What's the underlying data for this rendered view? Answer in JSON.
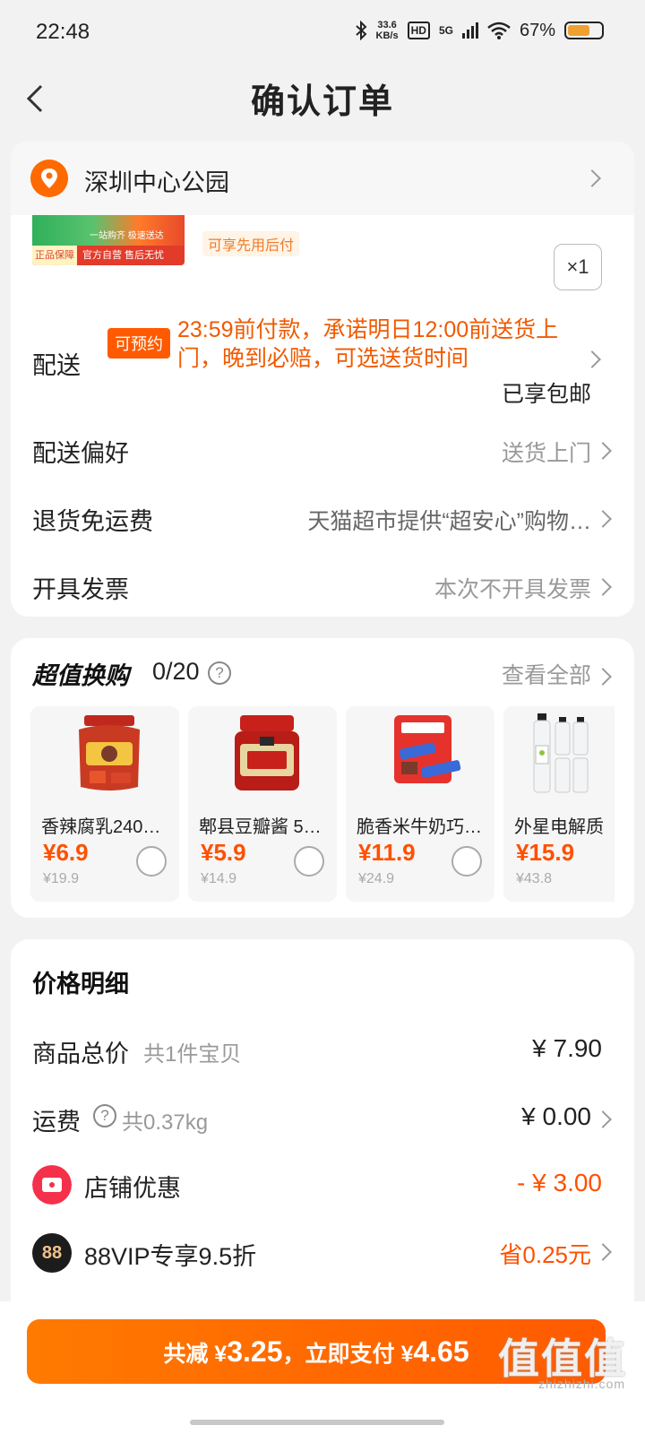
{
  "status_bar": {
    "time": "22:48",
    "net_speed_value": "33.6",
    "net_speed_unit": "KB/s",
    "hd": "HD",
    "network": "5G",
    "battery": "67%",
    "battery_level": 0.67
  },
  "nav": {
    "title": "确认订单"
  },
  "address": {
    "text": "深圳中心公园"
  },
  "product": {
    "thumb_badge": "正品保障",
    "thumb_service": "官方自营 售后无忧",
    "thumb_promo": "一站购齐 极速送达",
    "pay_later": "可享先用后付",
    "quantity": "×1"
  },
  "delivery": {
    "label": "配送",
    "tag": "可预约",
    "promise": "23:59前付款，承诺明日12:00前送货上门，晚到必赔，可选送货时间",
    "free_shipping": "已享包邮"
  },
  "order_rows": [
    {
      "label": "配送偏好",
      "value": "送货上门"
    },
    {
      "label": "退货免运费",
      "value": "天猫超市提供“超安心”购物…"
    },
    {
      "label": "开具发票",
      "value": "本次不开具发票"
    }
  ],
  "exchange": {
    "title": "超值换购",
    "count": "0/20",
    "view_all": "查看全部",
    "products": [
      {
        "name": "香辣腐乳240…",
        "price": "¥6.9",
        "old_price": "¥19.9"
      },
      {
        "name": "郫县豆瓣酱 5…",
        "price": "¥5.9",
        "old_price": "¥14.9"
      },
      {
        "name": "脆香米牛奶巧…",
        "price": "¥11.9",
        "old_price": "¥24.9"
      },
      {
        "name": "外星电解质",
        "price": "¥15.9",
        "old_price": "¥43.8"
      }
    ]
  },
  "price_detail": {
    "title": "价格明细",
    "goods_total_label": "商品总价",
    "goods_total_sub": "共1件宝贝",
    "goods_total_value": "¥ 7.90",
    "shipping_label": "运费",
    "shipping_sub": "共0.37kg",
    "shipping_value": "¥ 0.00",
    "shop_discount_label": "店铺优惠",
    "shop_discount_value": "- ¥ 3.00",
    "vip_label": "88VIP专享9.5折",
    "vip_badge": "88",
    "vip_value": "省0.25元"
  },
  "footer": {
    "pay_prefix": "共减 ¥",
    "reduced": "3.25",
    "pay_mid": "，立即支付 ¥",
    "pay_amount": "4.65",
    "watermark": "值值值",
    "watermark_url": "zhizhizhi.com"
  },
  "colors": {
    "accent": "#ff5a00",
    "discount": "#ff5000",
    "background": "#f2f2f2"
  }
}
